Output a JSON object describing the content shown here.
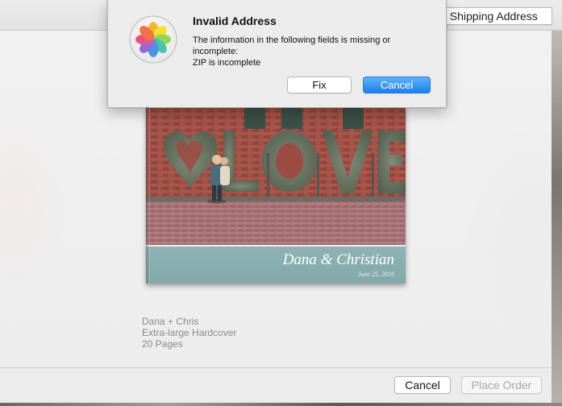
{
  "header": {
    "add_shipping_label": "ld Shipping Address"
  },
  "alert": {
    "title": "Invalid Address",
    "message_line1": "The information in the following fields is missing or",
    "message_line2": "incomplete:",
    "message_line3": "ZIP is incomplete",
    "fix_label": "Fix",
    "cancel_label": "Cancel",
    "icon": "photos-app-icon",
    "accent_color": "#2a86f3"
  },
  "book": {
    "cover_title": "Dana & Christian",
    "cover_date": "June 25, 2016",
    "band_color": "#8aaeb0"
  },
  "order": {
    "name": "Dana + Chris",
    "format": "Extra-large Hardcover",
    "pages": "20 Pages"
  },
  "footer": {
    "cancel_label": "Cancel",
    "place_order_label": "Place Order"
  }
}
